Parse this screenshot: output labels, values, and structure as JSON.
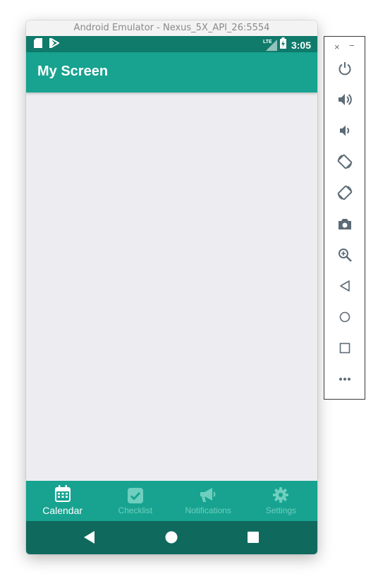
{
  "window": {
    "title": "Android Emulator - Nexus_5X_API_26:5554"
  },
  "statusbar": {
    "time": "3:05",
    "network": "LTE",
    "icons": [
      "sd-card-icon",
      "play-store-icon",
      "signal-icon",
      "battery-charging-icon"
    ]
  },
  "appbar": {
    "title": "My Screen"
  },
  "bottom_nav": {
    "items": [
      {
        "label": "Calendar",
        "icon": "calendar-icon",
        "active": true
      },
      {
        "label": "Checklist",
        "icon": "checkbox-icon",
        "active": false
      },
      {
        "label": "Notifications",
        "icon": "megaphone-icon",
        "active": false
      },
      {
        "label": "Settings",
        "icon": "gear-icon",
        "active": false
      }
    ]
  },
  "system_nav": {
    "buttons": [
      "back-icon",
      "home-icon",
      "recents-icon"
    ]
  },
  "side_toolbar": {
    "close_glyph": "×",
    "minimize_glyph": "−",
    "buttons": [
      "power-icon",
      "volume-up-icon",
      "volume-down-icon",
      "rotate-left-icon",
      "rotate-right-icon",
      "camera-icon",
      "zoom-icon",
      "back-icon",
      "home-icon",
      "overview-icon",
      "more-icon"
    ]
  },
  "colors": {
    "primary": "#17a390",
    "primary_dark": "#107a6b",
    "system_nav": "#0f695d",
    "content_bg": "#ededf1",
    "nav_inactive": "#6fcfbf"
  }
}
